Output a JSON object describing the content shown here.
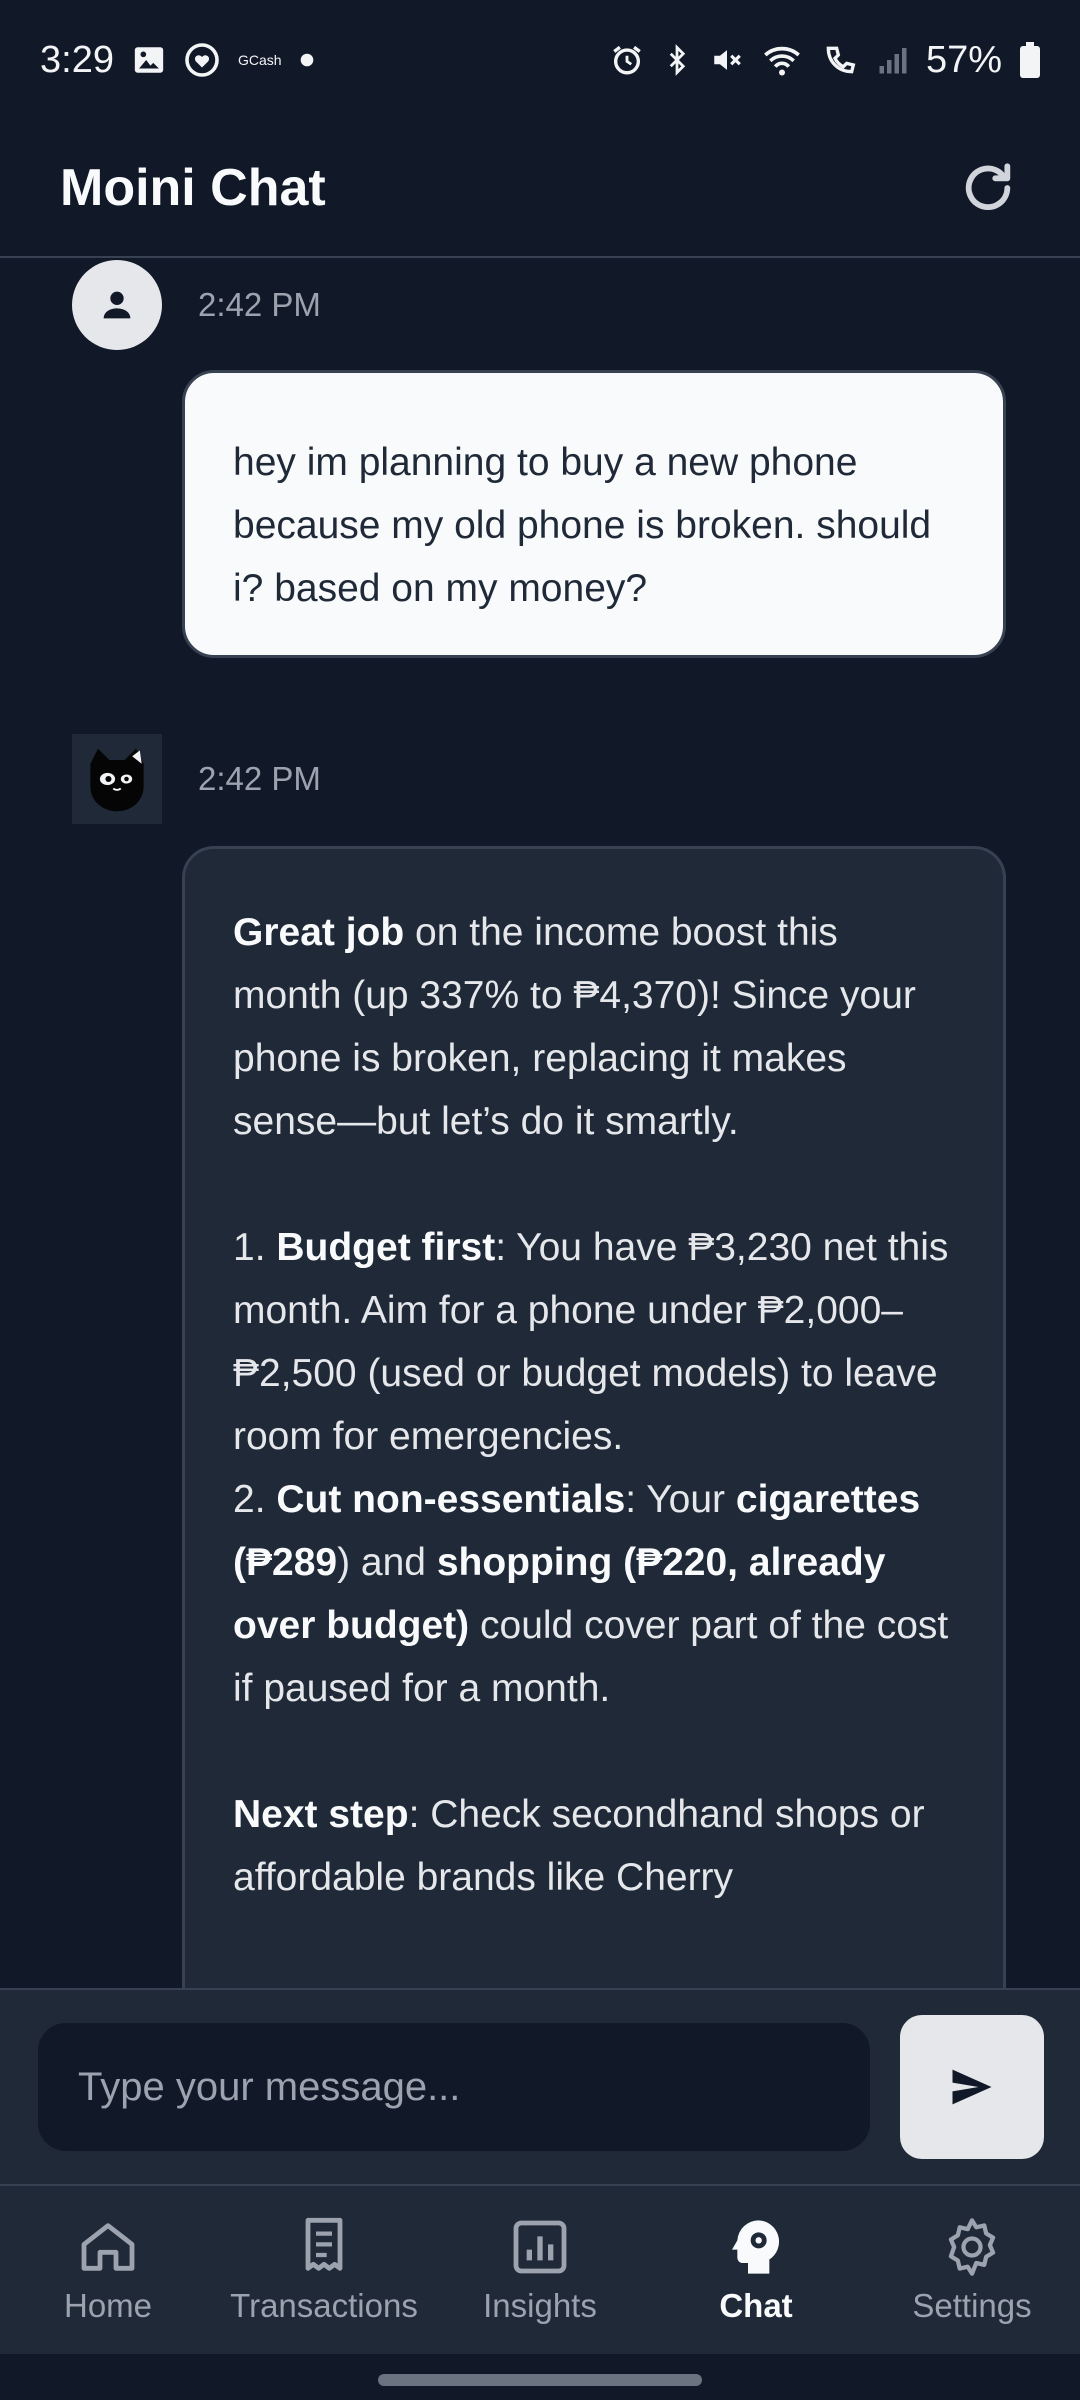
{
  "status_bar": {
    "time": "3:29",
    "notif_label": "GCash",
    "battery": "57%"
  },
  "app_bar": {
    "title": "Moini Chat"
  },
  "messages": [
    {
      "sender": "user",
      "time": "2:42 PM",
      "text": "hey im planning to buy a new phone because my old phone is broken. should i? based on my money?"
    },
    {
      "sender": "bot",
      "time": "2:42 PM",
      "p1_bold": "Great job",
      "p1_rest": " on the income boost this month (up 337% to ₱4,370)! Since your phone is broken, replacing it makes sense—but let’s do it smartly.",
      "item1_num": "1. ",
      "item1_bold": "Budget first",
      "item1_rest": ": You have ₱3,230 net this month. Aim for a phone under ₱2,000–₱2,500 (used or budget models) to leave room for emergencies.",
      "item2_num": "2. ",
      "item2_bold": "Cut non-essentials",
      "item2_mid1": ": Your ",
      "item2_bold2": "cigarettes (₱289",
      "item2_mid2": ") and ",
      "item2_bold3": "shopping (₱220, already over budget)",
      "item2_rest": " could cover part of the cost if paused for a month.",
      "next_bold": "Next step",
      "next_rest": ": Check secondhand shops or affordable brands like Cherry"
    }
  ],
  "input": {
    "placeholder": "Type your message..."
  },
  "nav": {
    "items": [
      {
        "label": "Home"
      },
      {
        "label": "Transactions"
      },
      {
        "label": "Insights"
      },
      {
        "label": "Chat"
      },
      {
        "label": "Settings"
      }
    ],
    "active": "Chat"
  },
  "colors": {
    "background": "#111827",
    "surface": "#1f2937",
    "border": "#374151",
    "user_bubble": "#f8fafc"
  }
}
